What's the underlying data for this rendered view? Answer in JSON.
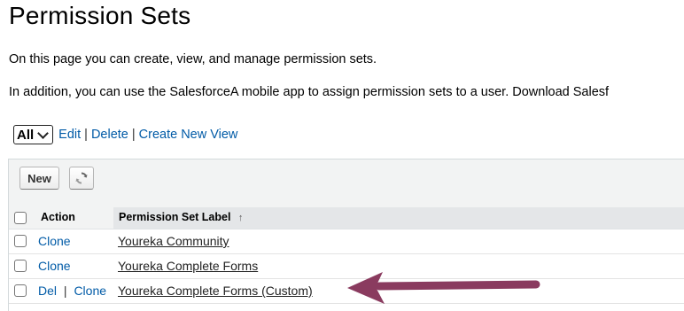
{
  "page": {
    "title": "Permission Sets",
    "intro": "On this page you can create, view, and manage permission sets.",
    "intro2": "In addition, you can use the SalesforceA mobile app to assign permission sets to a user. Download Salesf"
  },
  "view_bar": {
    "selected_view": "All",
    "edit_label": "Edit",
    "delete_label": "Delete",
    "create_label": "Create New View",
    "separator": "|"
  },
  "toolbar": {
    "new_label": "New",
    "refresh_icon": "refresh-icon"
  },
  "table": {
    "columns": [
      "Action",
      "Permission Set Label"
    ],
    "sort_indicator": "↑",
    "rows": [
      {
        "actions": [
          "Clone"
        ],
        "label": "Youreka Community"
      },
      {
        "actions": [
          "Clone"
        ],
        "label": "Youreka Complete Forms"
      },
      {
        "actions": [
          "Del",
          "Clone"
        ],
        "label": "Youreka Complete Forms (Custom)"
      }
    ]
  },
  "annotation": {
    "arrow_color": "#8a3b5f"
  }
}
